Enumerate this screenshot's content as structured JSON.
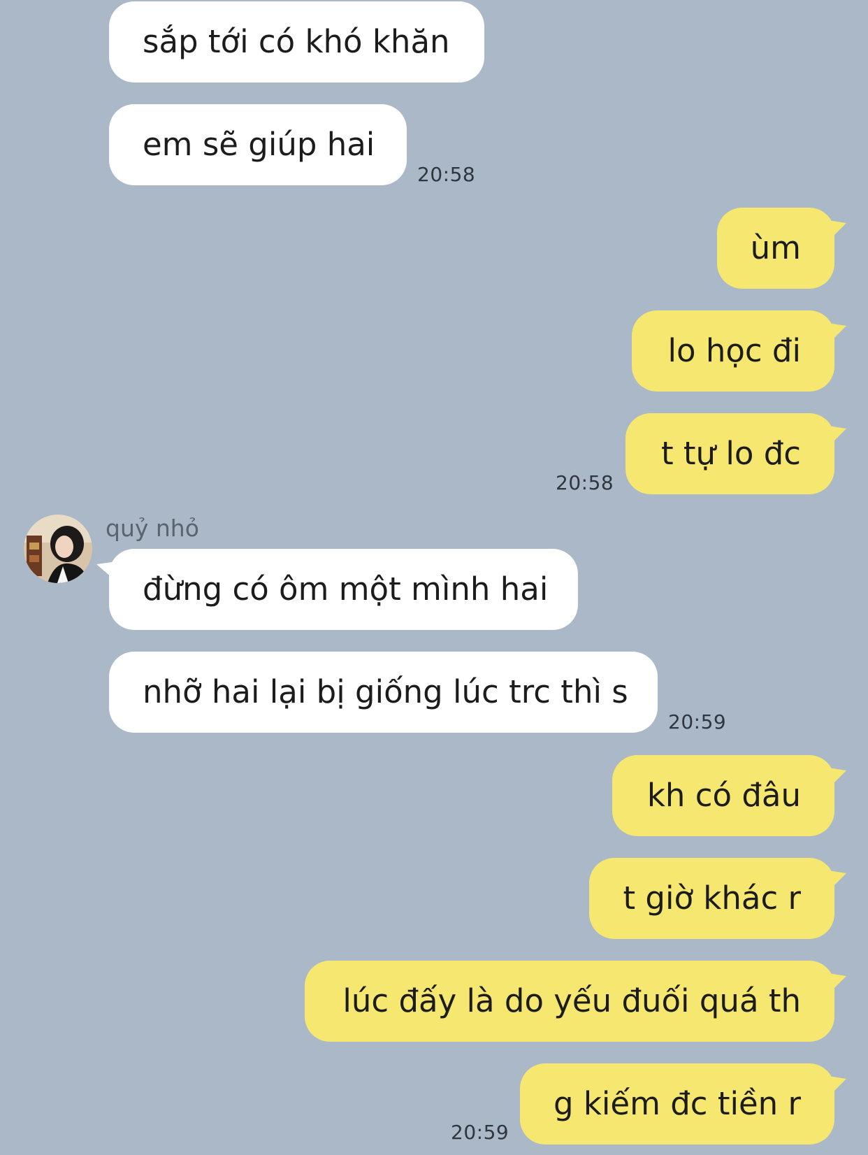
{
  "chat": {
    "sender_name": "quỷ nhỏ",
    "messages": [
      {
        "from": "them",
        "text": "sắp tới có khó khăn"
      },
      {
        "from": "them",
        "text": "em sẽ giúp hai",
        "time": "20:58"
      },
      {
        "from": "me",
        "text": "ùm"
      },
      {
        "from": "me",
        "text": "lo học đi"
      },
      {
        "from": "me",
        "text": "t tự lo đc",
        "time": "20:58"
      },
      {
        "from": "them",
        "text": "đừng có ôm một mình hai"
      },
      {
        "from": "them",
        "text": "nhỡ hai lại bị giống lúc trc thì s",
        "time": "20:59"
      },
      {
        "from": "me",
        "text": "kh có đâu"
      },
      {
        "from": "me",
        "text": "t giờ khác r"
      },
      {
        "from": "me",
        "text": "lúc đấy là do yếu đuối quá th"
      },
      {
        "from": "me",
        "text": "g kiếm đc tiền r",
        "time": "20:59"
      }
    ]
  },
  "colors": {
    "background": "#abb8c8",
    "incoming_bubble": "#ffffff",
    "outgoing_bubble": "#f5e76f"
  }
}
